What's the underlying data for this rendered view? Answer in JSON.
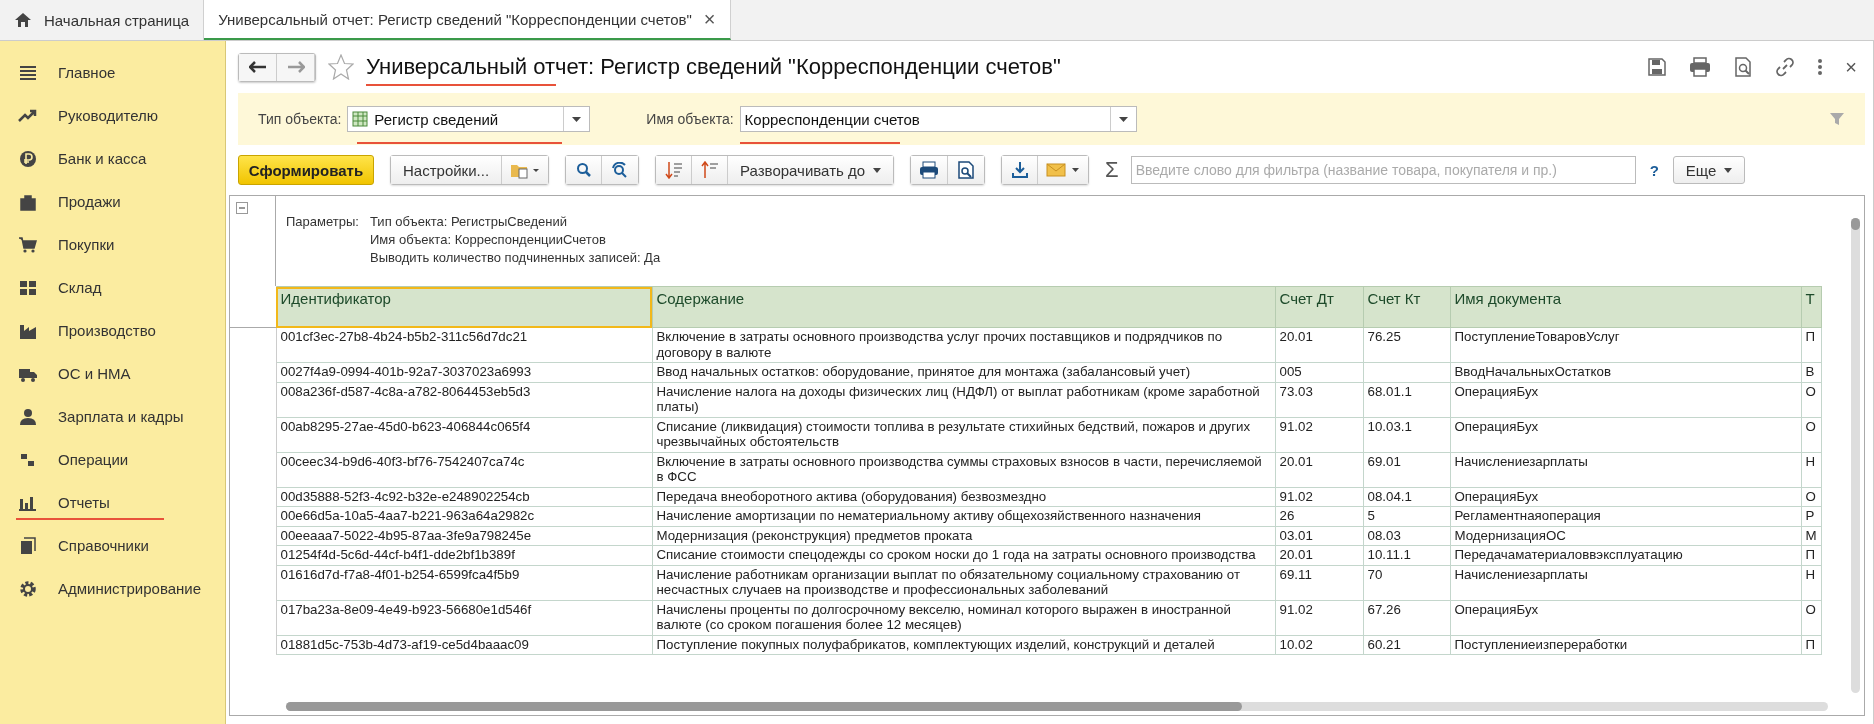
{
  "tabs": [
    {
      "label": "Начальная страница",
      "kind": "home",
      "selected": false
    },
    {
      "label": "Универсальный отчет: Регистр сведений \"Корреспонденции счетов\"",
      "kind": "doc",
      "selected": true,
      "close": "×"
    }
  ],
  "sidebar": {
    "items": [
      {
        "label": "Главное",
        "underlined": false
      },
      {
        "label": "Руководителю",
        "underlined": false
      },
      {
        "label": "Банк и касса",
        "underlined": false
      },
      {
        "label": "Продажи",
        "underlined": false
      },
      {
        "label": "Покупки",
        "underlined": false
      },
      {
        "label": "Склад",
        "underlined": false
      },
      {
        "label": "Производство",
        "underlined": false
      },
      {
        "label": "ОС и НМА",
        "underlined": false
      },
      {
        "label": "Зарплата и кадры",
        "underlined": false
      },
      {
        "label": "Операции",
        "underlined": false
      },
      {
        "label": "Отчеты",
        "underlined": true
      },
      {
        "label": "Справочники",
        "underlined": false
      },
      {
        "label": "Администрирование",
        "underlined": false
      }
    ]
  },
  "form": {
    "title": "Универсальный отчет: Регистр сведений \"Корреспонденции счетов\"",
    "title_underlined": true,
    "favorite": false,
    "close": "×"
  },
  "filters": [
    {
      "label": "Тип объекта:",
      "value": "Регистр сведений",
      "underlined": true
    },
    {
      "label": "Имя объекта:",
      "value": "Корреспонденции счетов",
      "underlined": true
    }
  ],
  "toolbar": {
    "generate": "Сформировать",
    "settings": "Настройки...",
    "expand": "Разворачивать до",
    "sum": "Σ",
    "search": {
      "placeholder": "Введите слово для фильтра (название товара, покупателя и пр.)"
    },
    "help": "?",
    "more": "Еще"
  },
  "report": {
    "parameters_label": "Параметры:",
    "parameters": [
      "Тип объекта: РегистрыСведений",
      "Имя объекта: КорреспонденцииСчетов",
      "Выводить количество подчиненных записей: Да"
    ],
    "columns": [
      "Идентификатор",
      "Содержание",
      "Счет Дт",
      "Счет Кт",
      "Имя документа",
      "Т"
    ],
    "rows": [
      [
        "001cf3ec-27b8-4b24-b5b2-311c56d7dc21",
        "Включение в затраты основного производства услуг прочих поставщиков и подрядчиков по договору в валюте",
        "20.01",
        "76.25",
        "ПоступлениеТоваровУслуг",
        "П"
      ],
      [
        "0027f4a9-0994-401b-92a7-3037023a6993",
        "Ввод начальных остатков: оборудование, принятое для монтажа (забалансовый учет)",
        "005",
        "",
        "ВводНачальныхОстатков",
        "В"
      ],
      [
        "008a236f-d587-4c8a-a782-8064453eb5d3",
        "Начисление налога на доходы физических лиц (НДФЛ) от выплат работникам (кроме заработной платы)",
        "73.03",
        "68.01.1",
        "ОперацияБух",
        "О"
      ],
      [
        "00ab8295-27ae-45d0-b623-406844c065f4",
        "Списание  (ликвидация) стоимости топлива в результате стихийных бедствий, пожаров и других чрезвычайных обстоятельств",
        "91.02",
        "10.03.1",
        "ОперацияБух",
        "О"
      ],
      [
        "00ceec34-b9d6-40f3-bf76-7542407ca74c",
        "Включение в затраты основного производства суммы страховых взносов в части, перечисляемой в ФСС",
        "20.01",
        "69.01",
        "Начислениезарплаты",
        "Н"
      ],
      [
        "00d35888-52f3-4c92-b32e-e248902254cb",
        "Передача внеоборотного актива (оборудования) безвозмездно",
        "91.02",
        "08.04.1",
        "ОперацияБух",
        "О"
      ],
      [
        "00e66d5a-10a5-4aa7-b221-963a64a2982c",
        "Начисление амортизации по нематериальному активу общехозяйственного назначения",
        "26",
        "5",
        "Регламентнаяоперация",
        "Р"
      ],
      [
        "00eeaaa7-5022-4b95-87aa-3fe9a798245e",
        "Модернизация (реконструкция) предметов проката",
        "03.01",
        "08.03",
        "МодернизацияОС",
        "М"
      ],
      [
        "01254f4d-5c6d-44cf-b4f1-dde2bf1b389f",
        "Списание стоимости спецодежды со сроком носки до 1 года на затраты основного производства",
        "20.01",
        "10.11.1",
        "Передачаматериаловвэксплуатацию",
        "П"
      ],
      [
        "01616d7d-f7a8-4f01-b254-6599fca4f5b9",
        "Начисление работникам организации выплат по обязательному социальному страхованию от несчастных случаев на производстве и профессиональных заболеваний",
        "69.11",
        "70",
        "Начислениезарплаты",
        "Н"
      ],
      [
        "017ba23a-8e09-4e49-b923-56680e1d546f",
        "Начислены проценты по долгосрочному векселю, номинал которого выражен в иностранной валюте (со сроком погашения более 12 месяцев)",
        "91.02",
        "67.26",
        "ОперацияБух",
        "О"
      ],
      [
        "01881d5c-753b-4d73-af19-ce5d4baaac09",
        "Поступление покупных полуфабрикатов, комплектующих изделий, конструкций и деталей",
        "10.02",
        "60.21",
        "Поступлениеизпереработки",
        "П"
      ]
    ]
  }
}
